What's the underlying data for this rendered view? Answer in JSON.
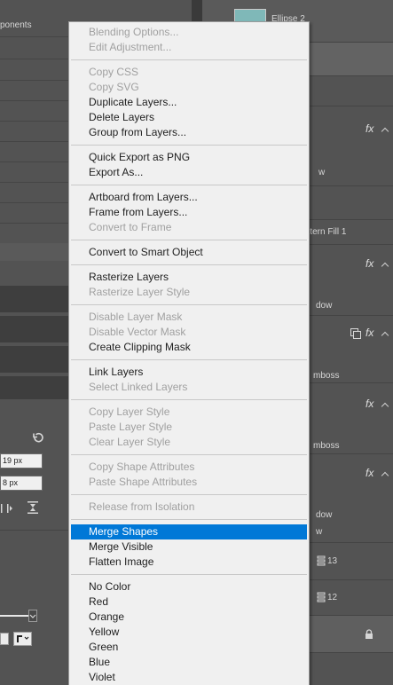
{
  "left_panel": {
    "top_label": "ponents",
    "field1": "19 px",
    "field2": "8 px"
  },
  "layers_panel": {
    "top_layer": "Ellipse 2",
    "pattern_fill": "attern Fill 1",
    "effects": [
      "w",
      "dow",
      "mboss",
      "mboss",
      "dow"
    ],
    "fx_label": "fx",
    "num1": "13",
    "num2": "12"
  },
  "context_menu": {
    "groups": [
      [
        {
          "label": "Blending Options...",
          "enabled": false
        },
        {
          "label": "Edit Adjustment...",
          "enabled": false
        }
      ],
      [
        {
          "label": "Copy CSS",
          "enabled": false
        },
        {
          "label": "Copy SVG",
          "enabled": false
        },
        {
          "label": "Duplicate Layers...",
          "enabled": true
        },
        {
          "label": "Delete Layers",
          "enabled": true
        },
        {
          "label": "Group from Layers...",
          "enabled": true
        }
      ],
      [
        {
          "label": "Quick Export as PNG",
          "enabled": true
        },
        {
          "label": "Export As...",
          "enabled": true
        }
      ],
      [
        {
          "label": "Artboard from Layers...",
          "enabled": true
        },
        {
          "label": "Frame from Layers...",
          "enabled": true
        },
        {
          "label": "Convert to Frame",
          "enabled": false
        }
      ],
      [
        {
          "label": "Convert to Smart Object",
          "enabled": true
        }
      ],
      [
        {
          "label": "Rasterize Layers",
          "enabled": true
        },
        {
          "label": "Rasterize Layer Style",
          "enabled": false
        }
      ],
      [
        {
          "label": "Disable Layer Mask",
          "enabled": false
        },
        {
          "label": "Disable Vector Mask",
          "enabled": false
        },
        {
          "label": "Create Clipping Mask",
          "enabled": true
        }
      ],
      [
        {
          "label": "Link Layers",
          "enabled": true
        },
        {
          "label": "Select Linked Layers",
          "enabled": false
        }
      ],
      [
        {
          "label": "Copy Layer Style",
          "enabled": false
        },
        {
          "label": "Paste Layer Style",
          "enabled": false
        },
        {
          "label": "Clear Layer Style",
          "enabled": false
        }
      ],
      [
        {
          "label": "Copy Shape Attributes",
          "enabled": false
        },
        {
          "label": "Paste Shape Attributes",
          "enabled": false
        }
      ],
      [
        {
          "label": "Release from Isolation",
          "enabled": false
        }
      ],
      [
        {
          "label": "Merge Shapes",
          "enabled": true,
          "highlighted": true
        },
        {
          "label": "Merge Visible",
          "enabled": true
        },
        {
          "label": "Flatten Image",
          "enabled": true
        }
      ],
      [
        {
          "label": "No Color",
          "enabled": true
        },
        {
          "label": "Red",
          "enabled": true
        },
        {
          "label": "Orange",
          "enabled": true
        },
        {
          "label": "Yellow",
          "enabled": true
        },
        {
          "label": "Green",
          "enabled": true
        },
        {
          "label": "Blue",
          "enabled": true
        },
        {
          "label": "Violet",
          "enabled": true
        }
      ]
    ]
  },
  "colors": {
    "highlight": "#0078d7",
    "menu_bg": "#f0f0f0",
    "panel_bg": "#535353"
  }
}
